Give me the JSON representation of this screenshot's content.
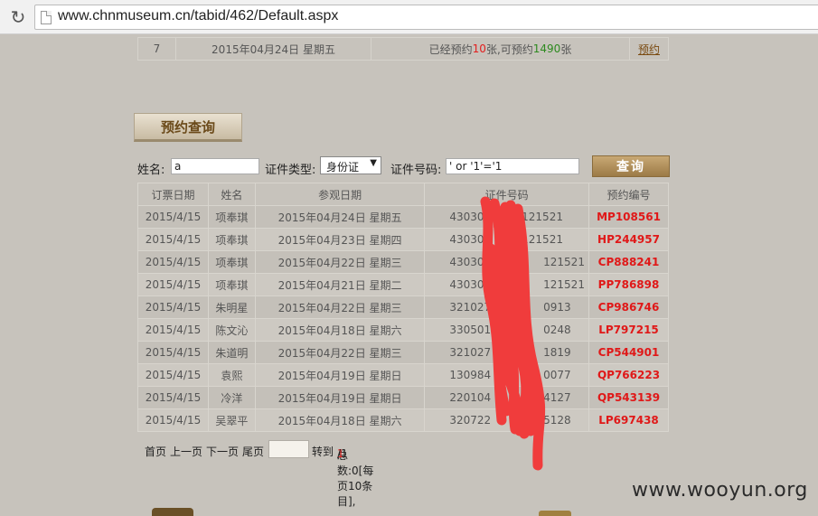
{
  "browser": {
    "url": "www.chnmuseum.cn/tabid/462/Default.aspx",
    "reload_icon": "reload-icon"
  },
  "top_row": {
    "index": "7",
    "date": "2015年04月24日 星期五",
    "prefix": "已经预约 ",
    "booked": "10",
    "middle": " 张,可预约 ",
    "available": "1490",
    "suffix": " 张",
    "link": "预约"
  },
  "tab": {
    "label": "预约查询"
  },
  "form": {
    "name_label": "姓名:",
    "name_value": "a",
    "id_type_label": "证件类型:",
    "id_type_value": "身份证",
    "id_no_label": "证件号码:",
    "id_no_value": "' or '1'='1",
    "query_button": "查询"
  },
  "table": {
    "headers": [
      "订票日期",
      "姓名",
      "参观日期",
      "证件号码",
      "预约编号"
    ],
    "rows": [
      {
        "order_date": "2015/4/15",
        "name": "项奉琪",
        "visit_date": "2015年04月24日 星期五",
        "id_prefix": "43030",
        "id_suffix": "2121521",
        "code": "MP108561"
      },
      {
        "order_date": "2015/4/15",
        "name": "项奉琪",
        "visit_date": "2015年04月23日 星期四",
        "id_prefix": "43030",
        "id_suffix": "2121521",
        "code": "HP244957"
      },
      {
        "order_date": "2015/4/15",
        "name": "项奉琪",
        "visit_date": "2015年04月22日 星期三",
        "id_prefix": "430305",
        "id_suffix": "121521",
        "code": "CP888241"
      },
      {
        "order_date": "2015/4/15",
        "name": "项奉琪",
        "visit_date": "2015年04月21日 星期二",
        "id_prefix": "430305",
        "id_suffix": "121521",
        "code": "PP786898"
      },
      {
        "order_date": "2015/4/15",
        "name": "朱明星",
        "visit_date": "2015年04月22日 星期三",
        "id_prefix": "321027",
        "id_suffix": "0913",
        "code": "CP986746"
      },
      {
        "order_date": "2015/4/15",
        "name": "陈文沁",
        "visit_date": "2015年04月18日 星期六",
        "id_prefix": "330501",
        "id_suffix": "0248",
        "code": "LP797215"
      },
      {
        "order_date": "2015/4/15",
        "name": "朱道明",
        "visit_date": "2015年04月22日 星期三",
        "id_prefix": "321027",
        "id_suffix": "1819",
        "code": "CP544901"
      },
      {
        "order_date": "2015/4/15",
        "name": "袁熙",
        "visit_date": "2015年04月19日 星期日",
        "id_prefix": "130984",
        "id_suffix": "0077",
        "code": "QP766223"
      },
      {
        "order_date": "2015/4/15",
        "name": "冷洋",
        "visit_date": "2015年04月19日 星期日",
        "id_prefix": "220104",
        "id_suffix": "4127",
        "code": "QP543139"
      },
      {
        "order_date": "2015/4/15",
        "name": "吴翠平",
        "visit_date": "2015年04月18日 星期六",
        "id_prefix": "320722",
        "id_suffix": "5128",
        "code": "LP697438"
      }
    ]
  },
  "pager": {
    "first": "首页",
    "prev": "上一页",
    "next": "下一页",
    "last": "尾页",
    "goto": "转到",
    "total_prefix": "总数:0[每页10条目],",
    "current_page": "1",
    "total_pages": "/1"
  },
  "watermark": "www.wooyun.org",
  "colors": {
    "background": "#c7c3bc",
    "accent_red": "#e01818",
    "accent_green": "#2d8a1f",
    "button_brown": "#a88552",
    "redaction": "#f03c3c"
  }
}
